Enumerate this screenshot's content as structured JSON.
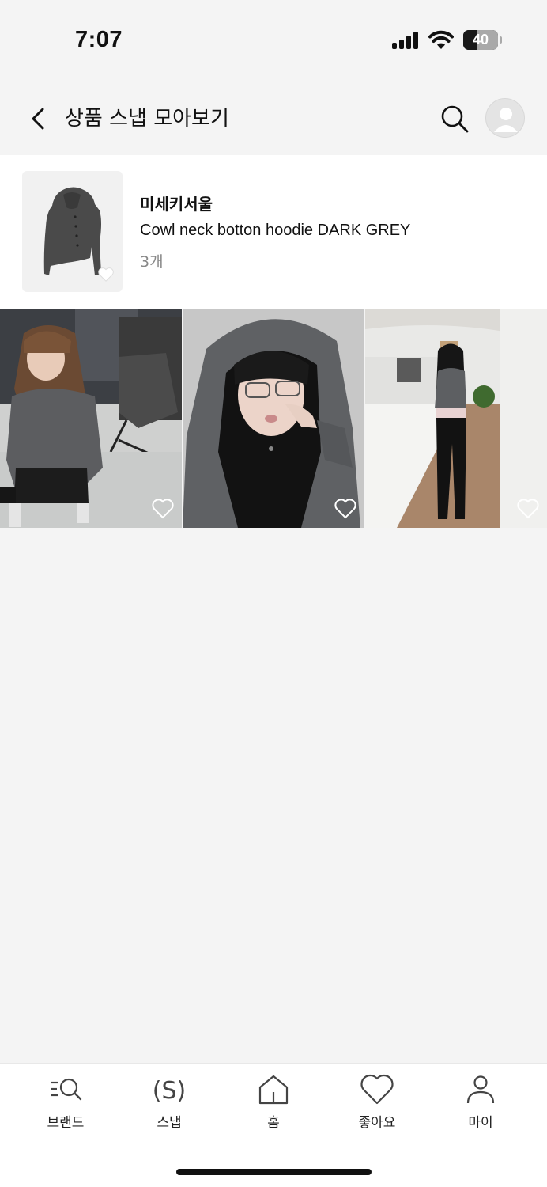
{
  "status_bar": {
    "time": "7:07",
    "battery_level": "40",
    "battery_fraction": 0.4
  },
  "header": {
    "title": "상품 스냅 모아보기",
    "back_icon": "chevron-left-icon",
    "search_icon": "search-icon",
    "avatar_icon": "user-avatar-icon"
  },
  "product": {
    "brand": "미세키서울",
    "name": "Cowl neck botton hoodie DARK GREY",
    "count": "3개",
    "like_icon": "heart-icon"
  },
  "snaps": [
    {
      "subject": "girl in grey cardigan in clothing store",
      "like_icon": "heart-outline-icon"
    },
    {
      "subject": "girl in grey hoodie selfie with glasses",
      "like_icon": "heart-outline-icon"
    },
    {
      "subject": "girl in grey top standing in hallway",
      "like_icon": "heart-outline-icon"
    }
  ],
  "bottom_nav": {
    "items": [
      {
        "label": "브랜드",
        "icon": "brand-search-icon"
      },
      {
        "label": "스냅",
        "icon": "snap-s-icon"
      },
      {
        "label": "홈",
        "icon": "home-icon"
      },
      {
        "label": "좋아요",
        "icon": "heart-icon"
      },
      {
        "label": "마이",
        "icon": "person-icon"
      }
    ]
  },
  "colors": {
    "background": "#f4f4f4",
    "surface": "#ffffff",
    "text": "#111111",
    "muted": "#888888"
  }
}
